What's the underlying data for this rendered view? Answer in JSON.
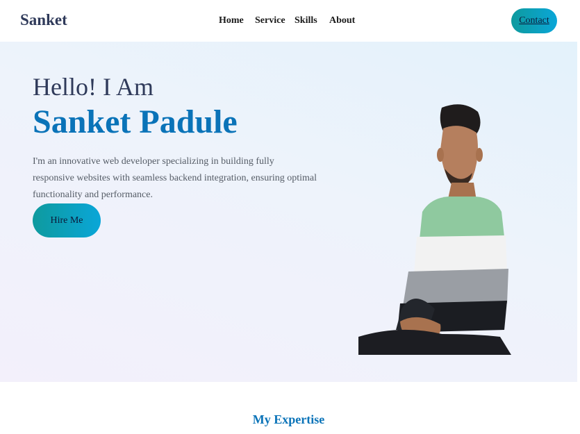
{
  "nav": {
    "logo": "Sanket",
    "links": [
      "Home",
      "Service",
      "Skills",
      "About"
    ],
    "contact_label": "Contact"
  },
  "hero": {
    "greeting": "Hello! I Am",
    "name": "Sanket Padule",
    "description": "I'm an innovative web developer specializing in building fully responsive websites with seamless backend integration, ensuring optimal functionality and performance.",
    "hire_label": "Hire Me"
  },
  "expertise": {
    "title": "My Expertise"
  },
  "colors": {
    "accent_blue": "#0a73b8",
    "button_gradient_start": "#0e9a9e",
    "button_gradient_end": "#0aa6d8",
    "heading_dark": "#2f3a5a"
  }
}
